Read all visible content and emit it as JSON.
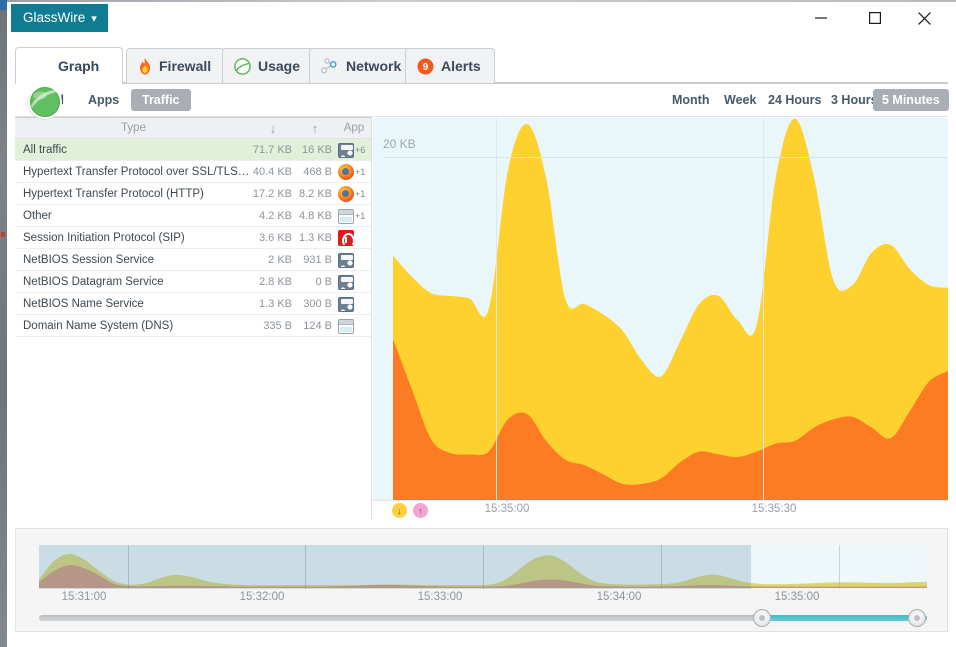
{
  "window": {
    "menu_button": "GlassWire",
    "menu_caret": "⌄",
    "minimize": "minimize-button",
    "maximize": "maximize-button",
    "close": "close-button"
  },
  "tabs": [
    {
      "label": "Graph",
      "icon": "glasswire-globe-icon",
      "active": true
    },
    {
      "label": "Firewall",
      "icon": "flame-icon",
      "active": false
    },
    {
      "label": "Usage",
      "icon": "green-circle-icon",
      "active": false
    },
    {
      "label": "Network",
      "icon": "nodes-icon",
      "active": false
    },
    {
      "label": "Alerts",
      "icon": "alert-badge-icon",
      "active": false,
      "badge": "9"
    }
  ],
  "subtabs": [
    {
      "label": "All",
      "selected": false
    },
    {
      "label": "Apps",
      "selected": false
    },
    {
      "label": "Traffic",
      "selected": true
    }
  ],
  "ranges": [
    {
      "label": "Month",
      "selected": false
    },
    {
      "label": "Week",
      "selected": false
    },
    {
      "label": "24 Hours",
      "selected": false
    },
    {
      "label": "3 Hours",
      "selected": false
    },
    {
      "label": "5 Minutes",
      "selected": true
    }
  ],
  "table": {
    "columns": {
      "type": "Type",
      "down": "↓",
      "up": "↑",
      "app": "App"
    },
    "rows": [
      {
        "type": "All traffic",
        "down": "71.7 KB",
        "up": "16 KB",
        "icon": "glasswire-icon",
        "extra": "+6",
        "selected": true
      },
      {
        "type": "Hypertext Transfer Protocol over SSL/TLS (HTT...",
        "down": "40.4 KB",
        "up": "468 B",
        "icon": "firefox-icon",
        "extra": "+1",
        "selected": false
      },
      {
        "type": "Hypertext Transfer Protocol (HTTP)",
        "down": "17.2 KB",
        "up": "8.2 KB",
        "icon": "firefox-icon",
        "extra": "+1",
        "selected": false
      },
      {
        "type": "Other",
        "down": "4.2 KB",
        "up": "4.8 KB",
        "icon": "window-icon",
        "extra": "+1",
        "selected": false
      },
      {
        "type": "Session Initiation Protocol (SIP)",
        "down": "3.6 KB",
        "up": "1.3 KB",
        "icon": "opera-icon",
        "extra": "",
        "selected": false
      },
      {
        "type": "NetBIOS Session Service",
        "down": "2 KB",
        "up": "931 B",
        "icon": "glasswire-icon",
        "extra": "",
        "selected": false
      },
      {
        "type": "NetBIOS Datagram Service",
        "down": "2.8 KB",
        "up": "0 B",
        "icon": "glasswire-icon",
        "extra": "",
        "selected": false
      },
      {
        "type": "NetBIOS Name Service",
        "down": "1.3 KB",
        "up": "300 B",
        "icon": "glasswire-icon",
        "extra": "",
        "selected": false
      },
      {
        "type": "Domain Name System (DNS)",
        "down": "335 B",
        "up": "124 B",
        "icon": "window-icon",
        "extra": "",
        "selected": false
      }
    ]
  },
  "chart_data": {
    "type": "area",
    "title": "",
    "xlabel": "",
    "ylabel": "20 KB",
    "ylim": [
      0,
      28
    ],
    "yticks": [
      "20 KB"
    ],
    "xticks": [
      "15:35:00",
      "15:35:30"
    ],
    "grid": true,
    "legend_position": "bottom-left",
    "legend": [
      {
        "name": "Download",
        "symbol": "↓",
        "color": "#ffcf3d"
      },
      {
        "name": "Upload",
        "symbol": "↑",
        "color": "#f3a3d0"
      }
    ],
    "series": [
      {
        "name": "Download",
        "color": "#ffd12e",
        "values": [
          18.2,
          16.6,
          15.4,
          15.2,
          15.0,
          14.2,
          24.5,
          28.0,
          24.0,
          15.0,
          14.6,
          13.8,
          12.6,
          10.4,
          9.2,
          11.8,
          14.6,
          15.2,
          13.4,
          13.0,
          24.0,
          28.4,
          24.0,
          16.4,
          16.0,
          18.4,
          19.0,
          17.2,
          16.0,
          15.8
        ]
      },
      {
        "name": "Upload",
        "color": "#fd7b22",
        "values": [
          12.0,
          8.2,
          4.5,
          3.5,
          3.4,
          3.6,
          6.0,
          6.4,
          4.4,
          3.0,
          2.6,
          1.9,
          1.2,
          1.2,
          1.6,
          2.8,
          3.6,
          3.4,
          3.2,
          3.6,
          4.2,
          4.4,
          5.4,
          6.0,
          6.2,
          5.4,
          4.6,
          6.6,
          8.8,
          9.6
        ]
      }
    ]
  },
  "timeline": {
    "xticks": [
      "15:31:00",
      "15:32:00",
      "15:33:00",
      "15:34:00",
      "15:35:00"
    ],
    "selection_start_label": "15:35:00",
    "chart_data": {
      "type": "area",
      "series": [
        {
          "name": "Download",
          "color": "#d8d36b",
          "values": [
            3.0,
            9.5,
            12.0,
            10.0,
            6.0,
            2.4,
            1.2,
            1.6,
            3.4,
            4.6,
            4.0,
            2.6,
            1.6,
            1.2,
            1.0,
            1.0,
            1.0,
            1.0,
            1.0,
            1.0,
            1.0,
            1.0,
            1.1,
            1.2,
            1.2,
            1.1,
            1.0,
            1.0,
            1.0,
            1.0,
            1.2,
            3.0,
            7.0,
            10.5,
            11.5,
            9.0,
            5.0,
            2.2,
            1.4,
            1.2,
            1.2,
            1.3,
            1.6,
            2.6,
            4.2,
            4.6,
            3.4,
            2.0,
            1.4,
            1.3,
            1.4,
            1.6,
            1.8,
            2.0,
            2.0,
            1.9,
            1.8,
            1.8,
            2.0,
            2.2
          ]
        },
        {
          "name": "Upload",
          "color": "#cf9272",
          "values": [
            2.0,
            6.0,
            8.0,
            7.0,
            4.4,
            1.4,
            0.7,
            0.6,
            0.7,
            0.8,
            0.8,
            0.7,
            0.6,
            0.5,
            0.5,
            0.5,
            0.5,
            0.5,
            0.5,
            0.5,
            0.6,
            0.8,
            1.0,
            1.1,
            1.0,
            0.8,
            0.6,
            0.5,
            0.5,
            0.5,
            0.5,
            0.8,
            1.6,
            2.6,
            3.0,
            2.6,
            1.6,
            0.8,
            0.6,
            0.5,
            0.5,
            0.5,
            0.6,
            0.8,
            1.0,
            1.0,
            0.8,
            0.6,
            0.5,
            0.5,
            0.5,
            0.5,
            0.5,
            0.5,
            0.5,
            0.5,
            0.5,
            0.5,
            0.5,
            0.5
          ]
        }
      ]
    }
  },
  "colors": {
    "brand_teal": "#0f7c92",
    "download_yellow": "#ffd12e",
    "upload_orange": "#fd7b22",
    "chart_bg": "#e9f6fa",
    "selected_row": "#e2f0d9",
    "slider_fill": "#3fbcc9",
    "alert_badge": "#f05a1e"
  }
}
